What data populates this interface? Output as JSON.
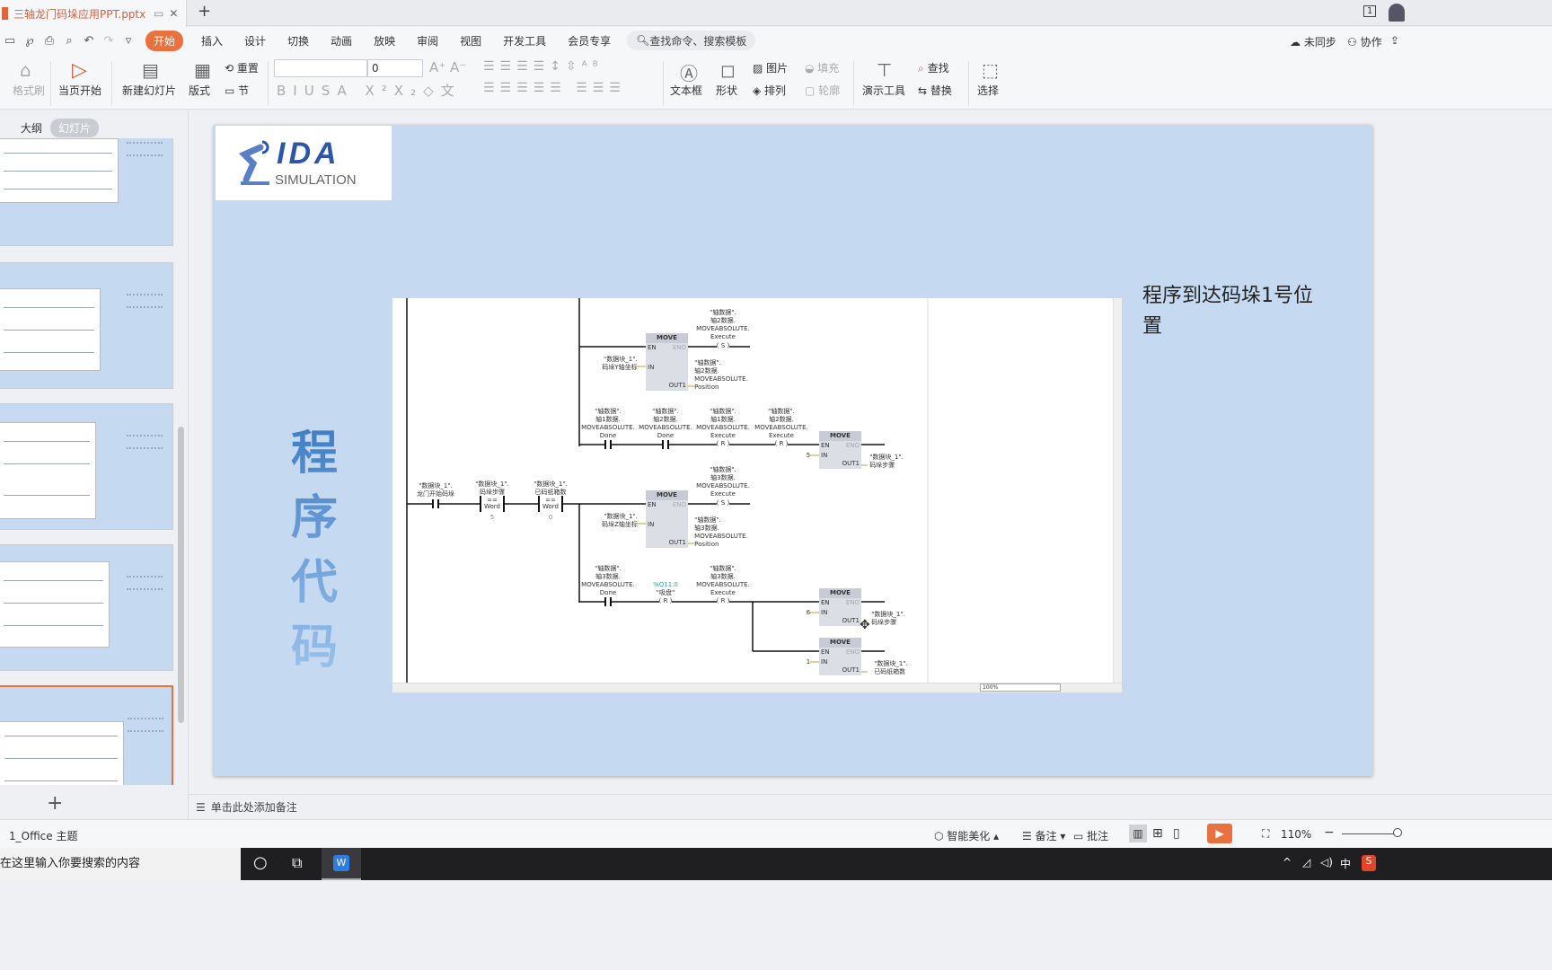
{
  "window": {
    "doc_tab": "三轴龙门码垛应用PPT.pptx",
    "new_tab": "+",
    "page_indicator": "1"
  },
  "menu": {
    "items": [
      "开始",
      "插入",
      "设计",
      "切换",
      "动画",
      "放映",
      "审阅",
      "视图",
      "开发工具",
      "会员专享"
    ],
    "search": "查找命令、搜索模板",
    "right": [
      "未同步",
      "协作"
    ]
  },
  "toolbar": {
    "format_painter": "格式刷",
    "play_current": "当页开始",
    "new_slide": "新建幻灯片",
    "layout": "版式",
    "reset": "重置",
    "section": "节",
    "font_size": "0",
    "textbox": "文本框",
    "shape": "形状",
    "picture": "图片",
    "arrange": "排列",
    "fill": "填充",
    "outline": "轮廓",
    "present_tools": "演示工具",
    "find": "查找",
    "replace": "替换",
    "select": "选择"
  },
  "panel": {
    "tabs": [
      "大纲",
      "幻灯片"
    ],
    "add": "+"
  },
  "slide": {
    "logo_text": "IDA",
    "logo_sub": "SIMULATION",
    "vertical_title": "程序代码",
    "caption": "程序到达码垛1号位置"
  },
  "ladder": {
    "rung1": {
      "coil_label": "\"轴数据\".\n轴2数据.\nMOVEABSOLUTE.\nExecute",
      "coil": "S",
      "in_label": "\"数据块_1\".\n码垛Y轴坐标",
      "out_label": "\"轴数据\".\n轴2数据.\nMOVEABSOLUTE.\nPosition"
    },
    "rung2": {
      "labels": [
        "\"轴数据\".\n轴1数据.\nMOVEABSOLUTE.\nDone",
        "\"轴数据\".\n轴2数据.\nMOVEABSOLUTE.\nDone",
        "\"轴数据\".\n轴1数据.\nMOVEABSOLUTE.\nExecute",
        "\"轴数据\".\n轴2数据.\nMOVEABSOLUTE.\nExecute"
      ],
      "coils": [
        "R",
        "R"
      ],
      "in": "5",
      "out_label": "\"数据块_1\".\n码垛步骤"
    },
    "main": {
      "labels": [
        "\"数据块_1\".\n龙门开始码垛",
        "\"数据块_1\".\n码垛步骤",
        "\"数据块_1\".\n已码纸箱数"
      ],
      "cmp": "==\nWord",
      "cmp_values": [
        "5",
        "0"
      ]
    },
    "rung3": {
      "coil_label": "\"轴数据\".\n轴3数据.\nMOVEABSOLUTE.\nExecute",
      "coil": "S",
      "in_label": "\"数据块_1\".\n码垛Z轴坐标",
      "out_label": "\"轴数据\".\n轴3数据.\nMOVEABSOLUTE.\nPosition"
    },
    "rung4": {
      "labels": [
        "\"轴数据\".\n轴3数据.\nMOVEABSOLUTE.\nDone",
        "%Q11.0",
        "\"吸盘\"",
        "\"轴数据\".\n轴3数据.\nMOVEABSOLUTE.\nExecute"
      ],
      "coils": [
        "R",
        "R"
      ],
      "in": [
        "6",
        "1"
      ],
      "out_labels": [
        "\"数据块_1\".\n码垛步骤",
        "\"数据块_1\".\n已码纸箱数"
      ]
    },
    "move": {
      "title": "MOVE",
      "en": "EN",
      "eno": "ENO",
      "in": "IN",
      "out": "OUT1"
    },
    "zoom": "100%",
    "address_color": "#2aa3a3"
  },
  "notes": {
    "placeholder": "单击此处添加备注"
  },
  "status": {
    "theme": "1_Office 主题",
    "beautify": "智能美化",
    "notes": "备注",
    "comment": "批注",
    "zoom": "110%"
  },
  "taskbar": {
    "search": "在这里输入你要搜索的内容",
    "ime": "中"
  },
  "colors": {
    "accent": "#e9713f",
    "slide_bg": "#c5daf0"
  }
}
